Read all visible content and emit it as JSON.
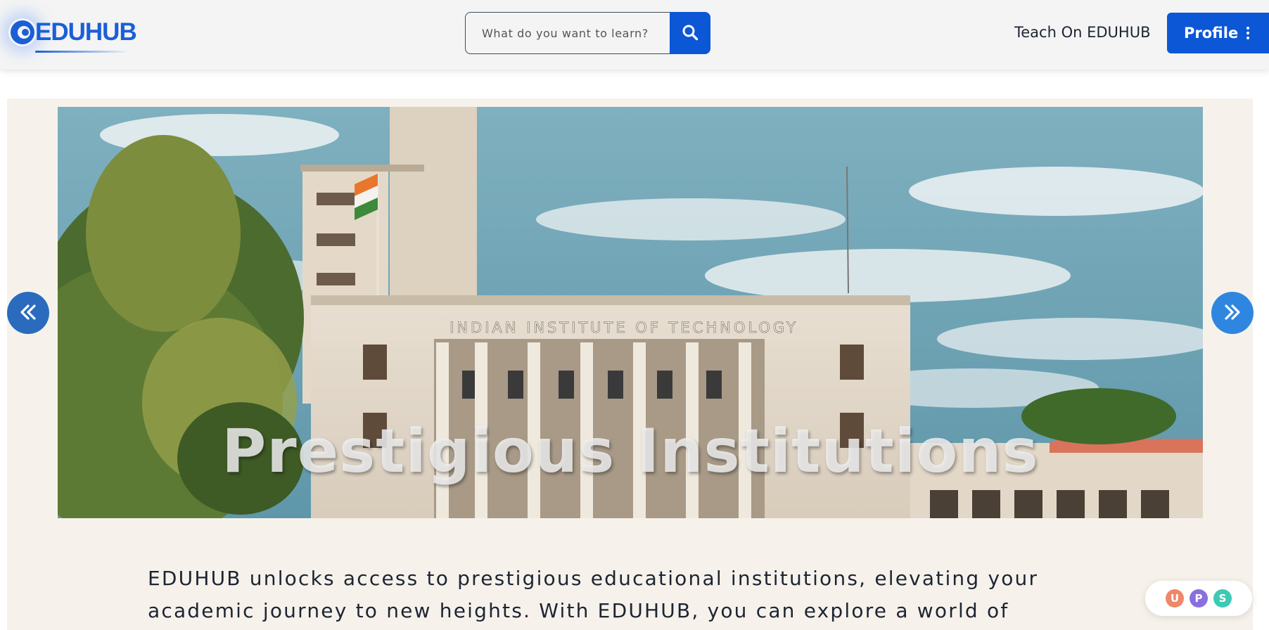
{
  "header": {
    "logo_text": "EDUHUB",
    "search": {
      "placeholder": "What do you want to learn?",
      "value": ""
    },
    "teach_link": "Teach On EDUHUB",
    "profile_button": "Profile"
  },
  "carousel": {
    "slide_caption": "Prestigious Institutions",
    "building_sign": "INDIAN INSTITUTE OF TECHNOLOGY"
  },
  "description": "EDUHUB unlocks access to prestigious educational institutions, elevating your academic journey to new heights. With EDUHUB, you can explore a world of",
  "avatars": [
    {
      "letter": "U",
      "color": "#f0876a"
    },
    {
      "letter": "P",
      "color": "#8b6fe0"
    },
    {
      "letter": "S",
      "color": "#3ec9b4"
    }
  ],
  "colors": {
    "brand": "#0b57d6",
    "nav_prev": "#2a6bbd",
    "nav_next": "#2f86e0",
    "section_bg": "#f6f2eb"
  },
  "icons": {
    "search": "search-icon",
    "profile_menu": "kebab-icon",
    "prev": "chevron-double-left-icon",
    "next": "chevron-double-right-icon"
  }
}
